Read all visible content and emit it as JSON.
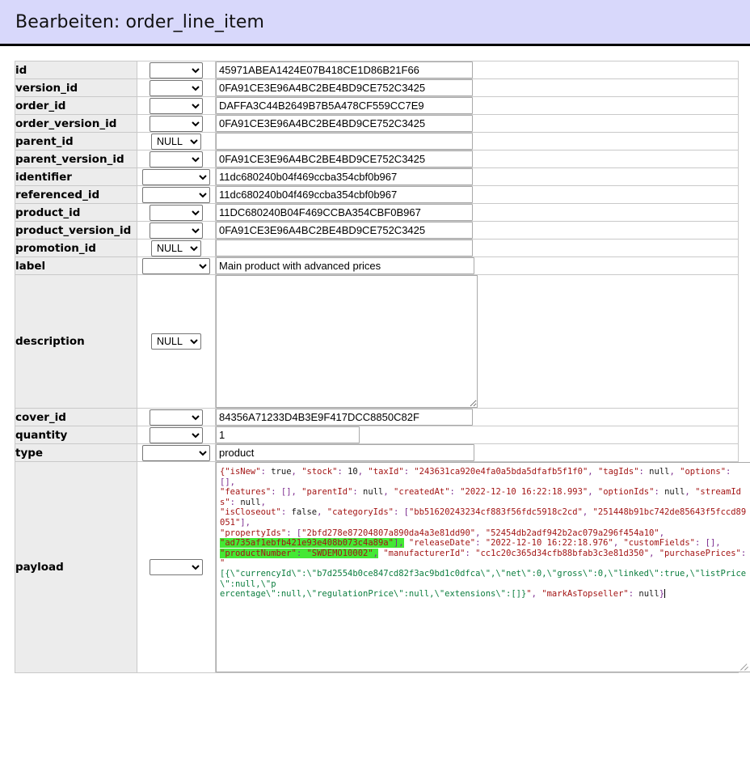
{
  "header": {
    "title": "Bearbeiten: order_line_item",
    "bg_color": "#d8d8fb"
  },
  "highlight_color": "#44e834",
  "select_options": {
    "blank": "",
    "null": "NULL"
  },
  "rows": [
    {
      "name": "id",
      "func": "",
      "value": "45971ABEA1424E07B418CE1D86B21F66",
      "control": "input"
    },
    {
      "name": "version_id",
      "func": "",
      "value": "0FA91CE3E96A4BC2BE4BD9CE752C3425",
      "control": "input"
    },
    {
      "name": "order_id",
      "func": "",
      "value": "DAFFA3C44B2649B7B5A478CF559CC7E9",
      "control": "input"
    },
    {
      "name": "order_version_id",
      "func": "",
      "value": "0FA91CE3E96A4BC2BE4BD9CE752C3425",
      "control": "input"
    },
    {
      "name": "parent_id",
      "func": "NULL",
      "value": "",
      "control": "input"
    },
    {
      "name": "parent_version_id",
      "func": "",
      "value": "0FA91CE3E96A4BC2BE4BD9CE752C3425",
      "control": "input"
    },
    {
      "name": "identifier",
      "func": "",
      "value": "11dc680240b04f469ccba354cbf0b967",
      "control": "input"
    },
    {
      "name": "referenced_id",
      "func": "",
      "value": "11dc680240b04f469ccba354cbf0b967",
      "control": "input"
    },
    {
      "name": "product_id",
      "func": "",
      "value": "11DC680240B04F469CCBA354CBF0B967",
      "control": "input"
    },
    {
      "name": "product_version_id",
      "func": "",
      "value": "0FA91CE3E96A4BC2BE4BD9CE752C3425",
      "control": "input"
    },
    {
      "name": "promotion_id",
      "func": "NULL",
      "value": "",
      "control": "input"
    },
    {
      "name": "label",
      "func": "",
      "value": "Main product with advanced prices",
      "control": "input"
    },
    {
      "name": "description",
      "func": "NULL",
      "value": "",
      "control": "textarea"
    },
    {
      "name": "cover_id",
      "func": "",
      "value": "84356A71233D4B3E9F417DCC8850C82F",
      "control": "input"
    },
    {
      "name": "quantity",
      "func": "",
      "value": "1",
      "control": "input"
    },
    {
      "name": "type",
      "func": "",
      "value": "product",
      "control": "input"
    },
    {
      "name": "payload",
      "func": "",
      "value": "",
      "control": "payload"
    }
  ],
  "payload": {
    "label": "payload",
    "func": "",
    "text": "{\"isNew\": true, \"stock\": 10, \"taxId\": \"243631ca920e4fa0a5bda5dfafb5f1f0\", \"tagIds\": null, \"options\": [], \"features\": [], \"parentId\": null, \"createdAt\": \"2022-12-10 16:22:18.993\", \"optionIds\": null, \"streamIds\": null, \"isCloseout\": false, \"categoryIds\": [\"bb51620243234cf883f56fdc5918c2cd\", \"251448b91bc742de85643f5fccd89051\"], \"propertyIds\": [\"2bfd278e87204807a890da4a3e81dd90\", \"52454db2adf942b2ac079a296f454a10\", \"ad735af1ebfb421e93e408b073c4a89a\"], \"releaseDate\": \"2022-12-10 16:22:18.976\", \"customFields\": [], \"productNumber\": \"SWDEMO10002\", \"manufacturerId\": \"cc1c20c365d34cfb88bfab3c3e81d350\", \"purchasePrices\": \"[{\\\"currencyId\\\":\\\"b7d2554b0ce847cd82f3ac9bd1c0dfca\\\",\\\"net\\\":0,\\\"gross\\\":0,\\\"linked\\\":true,\\\"listPrice\\\":null,\\\"percentage\\\":null,\\\"regulationPrice\\\":null,\\\"extensions\\\":[]}\", \"markAsTopseller\": null}",
    "highlighted_fragment": "\"ad735af1ebfb421e93e408b073c4a89a\"], \"productNumber\": \"SWDEMO10002\",",
    "lines": [
      "{\"isNew\": true, \"stock\": 10, \"taxId\": \"243631ca920e4fa0a5bda5dfafb5f1f0\", \"tagIds\": null, \"options\": [],",
      "\"features\": [], \"parentId\": null, \"createdAt\": \"2022-12-10 16:22:18.993\", \"optionIds\": null, \"streamIds\": null,",
      "\"isCloseout\": false, \"categoryIds\": [\"bb51620243234cf883f56fdc5918c2cd\", \"251448b91bc742de85643f5fccd89051\"],",
      "\"propertyIds\": [\"2bfd278e87204807a890da4a3e81dd90\", \"52454db2adf942b2ac079a296f454a10\",",
      "\"ad735af1ebfb421e93e408b073c4a89a\"], \"releaseDate\": \"2022-12-10 16:22:18.976\", \"customFields\": [],",
      "\"productNumber\": \"SWDEMO10002\", \"manufacturerId\": \"cc1c20c365d34cfb88bfab3c3e81d350\", \"purchasePrices\": \"",
      "[{\\\"currencyId\\\":\\\"b7d2554b0ce847cd82f3ac9bd1c0dfca\\\",\\\"net\\\":0,\\\"gross\\\":0,\\\"linked\\\":true,\\\"listPrice\\\":null,\\\"p",
      "ercentage\\\":null,\\\"regulationPrice\\\":null,\\\"extensions\\\":[]}\", \"markAsTopseller\": null}"
    ]
  }
}
